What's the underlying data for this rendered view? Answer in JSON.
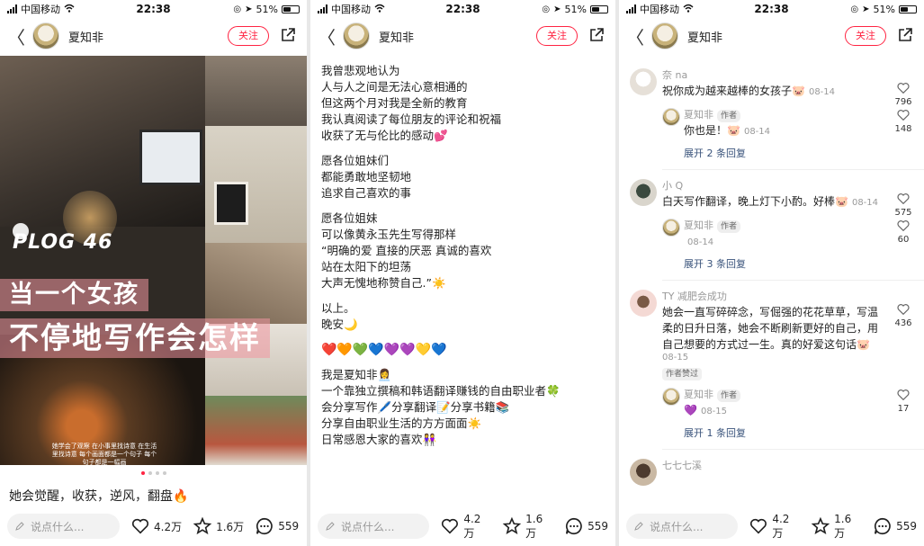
{
  "status": {
    "carrier": "中国移动",
    "time": "22:38",
    "battery": "51%",
    "battery_level": 0.51
  },
  "header": {
    "author": "夏知非",
    "follow_label": "关注"
  },
  "panel1": {
    "cover": {
      "plog": "PLOG 46",
      "title_line1": "当一个女孩",
      "title_line2": "不停地写作会怎样",
      "small_text": "她学会了观察 在小事里找诗意 在生活里找诗意 每个画面都是一个句子 每个句子都是一幅画"
    },
    "caption": "她会觉醒，收获，逆风，翻盘🔥"
  },
  "panel2": {
    "paragraphs": [
      [
        "我曾悲观地认为",
        "人与人之间是无法心意相通的",
        "但这两个月对我是全新的教育",
        "我认真阅读了每位朋友的评论和祝福",
        "收获了无与伦比的感动💕"
      ],
      [
        "愿各位姐妹们",
        "都能勇敢地坚韧地",
        "追求自己喜欢的事"
      ],
      [
        "愿各位姐妹",
        "可以像黄永玉先生写得那样",
        "“明确的爱 直接的厌恶 真诚的喜欢",
        "站在太阳下的坦荡",
        "大声无愧地称赞自己.”☀️"
      ],
      [
        "以上。",
        "晚安🌙"
      ]
    ],
    "hearts": "❤️🧡💚💙💜💜💛💙",
    "intro": [
      "我是夏知非👩‍💼",
      "一个靠独立撰稿和韩语翻译赚钱的自由职业者🍀",
      "会分享写作🖊️分享翻译📝分享书籍📚",
      "分享自由职业生活的方方面面☀️",
      "日常感恩大家的喜欢👭"
    ]
  },
  "panel3": {
    "comments": [
      {
        "name": "奈 na",
        "text": "祝你成为越来越棒的女孩子🐷",
        "date": "08-14",
        "likes": "796",
        "reply": {
          "name": "夏知非",
          "tag": "作者",
          "text": "你也是！🐷",
          "date": "08-14",
          "likes": "148"
        },
        "expand": "展开 2 条回复"
      },
      {
        "name": "小 Q",
        "text": "白天写作翻译，晚上灯下小酌。好棒🐷",
        "date": "08-14",
        "likes": "575",
        "reply": {
          "name": "夏知非",
          "tag": "作者",
          "text": "",
          "date": "08-14",
          "likes": "60"
        },
        "expand": "展开 3 条回复"
      },
      {
        "name": "TY 减肥会成功",
        "text": "她会一直写碎碎念，写倔强的花花草草，写温柔的日升日落，她会不断刷新更好的自己，用自己想要的方式过一生。真的好爱这句话🐷",
        "date": "08-15",
        "likes": "436",
        "author_liked": "作者赞过",
        "reply": {
          "name": "夏知非",
          "tag": "作者",
          "text": "💜",
          "date": "08-15",
          "likes": "17"
        },
        "expand": "展开 1 条回复"
      },
      {
        "name": "七七七溪",
        "text": "",
        "date": "",
        "likes": ""
      }
    ]
  },
  "bottom": {
    "placeholder": "说点什么...",
    "likes": "4.2万",
    "stars": "1.6万",
    "comments": "559"
  }
}
